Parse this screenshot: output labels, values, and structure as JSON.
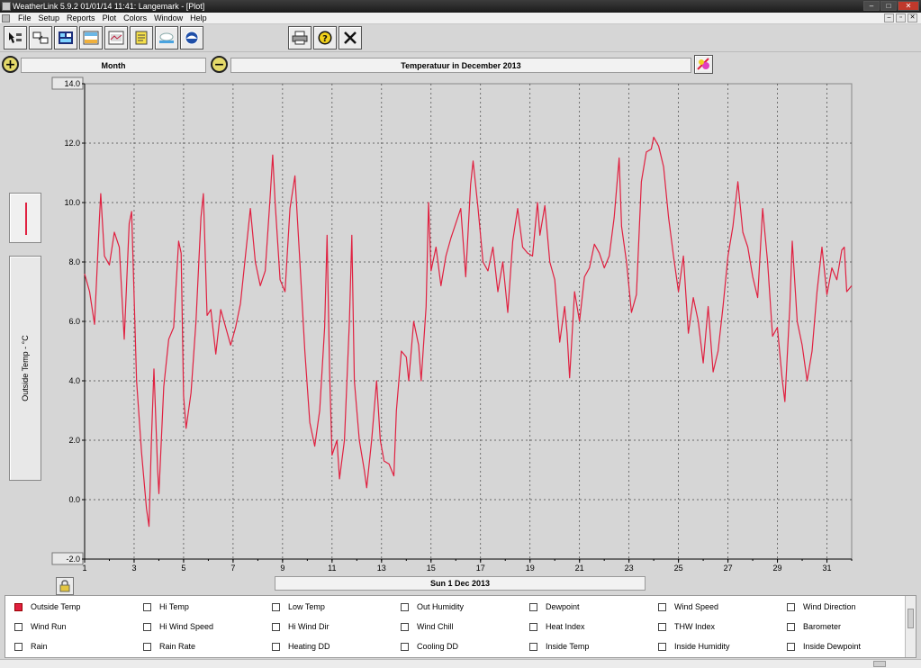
{
  "window": {
    "title": "WeatherLink 5.9.2  01/01/14  11:41: Langemark - [Plot]",
    "controls": [
      "–",
      "□",
      "✕"
    ],
    "mdi_controls": [
      "–",
      "▫",
      "✕"
    ]
  },
  "menu": {
    "items": [
      "File",
      "Setup",
      "Reports",
      "Plot",
      "Colors",
      "Window",
      "Help"
    ]
  },
  "toolbar": {
    "buttons": [
      {
        "name": "select-station-icon"
      },
      {
        "name": "download-icon"
      },
      {
        "name": "bulletin-icon"
      },
      {
        "name": "summary-icon"
      },
      {
        "name": "plot-icon"
      },
      {
        "name": "browse-notes-icon"
      },
      {
        "name": "weather-image-icon"
      },
      {
        "name": "noaa-icon"
      },
      {
        "name": "print-icon"
      },
      {
        "name": "help-icon"
      },
      {
        "name": "close-plot-icon"
      }
    ]
  },
  "header": {
    "period": "Month",
    "plot_title": "Temperatuur in December 2013"
  },
  "y_axis": {
    "title": "Outside Temp - °C"
  },
  "date_label": "Sun 1 Dec 2013",
  "variables": [
    {
      "label": "Outside Temp",
      "checked": true
    },
    {
      "label": "Hi Temp",
      "checked": false
    },
    {
      "label": "Low Temp",
      "checked": false
    },
    {
      "label": "Out Humidity",
      "checked": false
    },
    {
      "label": "Dewpoint",
      "checked": false
    },
    {
      "label": "Wind Speed",
      "checked": false
    },
    {
      "label": "Wind Direction",
      "checked": false
    },
    {
      "label": "Wind Run",
      "checked": false
    },
    {
      "label": "Hi Wind Speed",
      "checked": false
    },
    {
      "label": "Hi Wind Dir",
      "checked": false
    },
    {
      "label": "Wind Chill",
      "checked": false
    },
    {
      "label": "Heat Index",
      "checked": false
    },
    {
      "label": "THW Index",
      "checked": false
    },
    {
      "label": "Barometer",
      "checked": false
    },
    {
      "label": "Rain",
      "checked": false
    },
    {
      "label": "Rain Rate",
      "checked": false
    },
    {
      "label": "Heating DD",
      "checked": false
    },
    {
      "label": "Cooling DD",
      "checked": false
    },
    {
      "label": "Inside Temp",
      "checked": false
    },
    {
      "label": "Inside Humidity",
      "checked": false
    },
    {
      "label": "Inside Dewpoint",
      "checked": false
    }
  ],
  "colors": {
    "series": "#e02040"
  },
  "chart_data": {
    "type": "line",
    "ylim": [
      -2,
      14
    ],
    "xlim": [
      1,
      32
    ],
    "y_ticks": [
      "14.0",
      "12.0",
      "10.0",
      "8.0",
      "6.0",
      "4.0",
      "2.0",
      "0.0",
      "-2.0"
    ],
    "x_ticks": [
      "1",
      "3",
      "5",
      "7",
      "9",
      "11",
      "13",
      "15",
      "17",
      "19",
      "21",
      "23",
      "25",
      "27",
      "29",
      "31"
    ],
    "grid": true,
    "series": [
      {
        "values": [
          [
            1.0,
            7.6
          ],
          [
            1.2,
            7.0
          ],
          [
            1.4,
            5.9
          ],
          [
            1.6,
            9.5
          ],
          [
            1.65,
            10.3
          ],
          [
            1.8,
            8.2
          ],
          [
            2.0,
            7.9
          ],
          [
            2.2,
            9.0
          ],
          [
            2.4,
            8.5
          ],
          [
            2.6,
            5.4
          ],
          [
            2.8,
            9.3
          ],
          [
            2.9,
            9.7
          ],
          [
            3.1,
            4.0
          ],
          [
            3.3,
            1.6
          ],
          [
            3.5,
            -0.3
          ],
          [
            3.6,
            -0.9
          ],
          [
            3.7,
            2.0
          ],
          [
            3.8,
            4.4
          ],
          [
            3.95,
            1.0
          ],
          [
            4.0,
            0.2
          ],
          [
            4.2,
            3.8
          ],
          [
            4.4,
            5.4
          ],
          [
            4.6,
            5.8
          ],
          [
            4.8,
            8.7
          ],
          [
            4.9,
            8.3
          ],
          [
            5.0,
            3.5
          ],
          [
            5.1,
            2.4
          ],
          [
            5.3,
            3.6
          ],
          [
            5.5,
            6.0
          ],
          [
            5.7,
            9.5
          ],
          [
            5.8,
            10.3
          ],
          [
            5.95,
            6.2
          ],
          [
            6.1,
            6.4
          ],
          [
            6.3,
            4.9
          ],
          [
            6.5,
            6.4
          ],
          [
            6.7,
            5.8
          ],
          [
            6.9,
            5.2
          ],
          [
            7.1,
            5.8
          ],
          [
            7.3,
            6.6
          ],
          [
            7.5,
            8.2
          ],
          [
            7.7,
            9.8
          ],
          [
            7.9,
            8.0
          ],
          [
            8.1,
            7.2
          ],
          [
            8.3,
            7.7
          ],
          [
            8.5,
            10.2
          ],
          [
            8.6,
            11.6
          ],
          [
            8.7,
            10.0
          ],
          [
            8.9,
            7.4
          ],
          [
            9.1,
            7.0
          ],
          [
            9.3,
            9.8
          ],
          [
            9.5,
            10.9
          ],
          [
            9.7,
            8.0
          ],
          [
            9.9,
            5.0
          ],
          [
            10.1,
            2.6
          ],
          [
            10.3,
            1.8
          ],
          [
            10.5,
            3.0
          ],
          [
            10.7,
            5.8
          ],
          [
            10.8,
            8.9
          ],
          [
            10.9,
            4.3
          ],
          [
            11.0,
            1.5
          ],
          [
            11.2,
            2.0
          ],
          [
            11.3,
            0.7
          ],
          [
            11.5,
            2.0
          ],
          [
            11.7,
            6.0
          ],
          [
            11.8,
            8.9
          ],
          [
            11.9,
            4.0
          ],
          [
            12.1,
            2.0
          ],
          [
            12.3,
            1.0
          ],
          [
            12.4,
            0.4
          ],
          [
            12.6,
            2.0
          ],
          [
            12.8,
            4.0
          ],
          [
            12.95,
            2.0
          ],
          [
            13.1,
            1.3
          ],
          [
            13.3,
            1.2
          ],
          [
            13.5,
            0.8
          ],
          [
            13.6,
            3.0
          ],
          [
            13.8,
            5.0
          ],
          [
            14.0,
            4.8
          ],
          [
            14.1,
            4.0
          ],
          [
            14.3,
            6.0
          ],
          [
            14.5,
            5.2
          ],
          [
            14.6,
            4.0
          ],
          [
            14.8,
            6.5
          ],
          [
            14.9,
            10.0
          ],
          [
            15.0,
            7.7
          ],
          [
            15.2,
            8.5
          ],
          [
            15.4,
            7.2
          ],
          [
            15.6,
            8.2
          ],
          [
            15.8,
            8.8
          ],
          [
            16.0,
            9.3
          ],
          [
            16.2,
            9.8
          ],
          [
            16.4,
            7.5
          ],
          [
            16.6,
            10.6
          ],
          [
            16.7,
            11.4
          ],
          [
            16.9,
            9.8
          ],
          [
            17.1,
            8.0
          ],
          [
            17.3,
            7.7
          ],
          [
            17.5,
            8.5
          ],
          [
            17.7,
            7.0
          ],
          [
            17.9,
            8.0
          ],
          [
            18.1,
            6.3
          ],
          [
            18.3,
            8.7
          ],
          [
            18.5,
            9.8
          ],
          [
            18.7,
            8.5
          ],
          [
            18.9,
            8.3
          ],
          [
            19.1,
            8.2
          ],
          [
            19.3,
            10.0
          ],
          [
            19.4,
            8.9
          ],
          [
            19.6,
            9.9
          ],
          [
            19.8,
            8.0
          ],
          [
            20.0,
            7.4
          ],
          [
            20.2,
            5.3
          ],
          [
            20.4,
            6.5
          ],
          [
            20.5,
            5.6
          ],
          [
            20.6,
            4.1
          ],
          [
            20.8,
            7.0
          ],
          [
            21.0,
            6.0
          ],
          [
            21.2,
            7.5
          ],
          [
            21.4,
            7.8
          ],
          [
            21.6,
            8.6
          ],
          [
            21.8,
            8.3
          ],
          [
            22.0,
            7.8
          ],
          [
            22.2,
            8.2
          ],
          [
            22.4,
            9.5
          ],
          [
            22.6,
            11.5
          ],
          [
            22.7,
            9.2
          ],
          [
            22.9,
            8.0
          ],
          [
            23.1,
            6.3
          ],
          [
            23.3,
            6.9
          ],
          [
            23.5,
            10.7
          ],
          [
            23.7,
            11.7
          ],
          [
            23.9,
            11.8
          ],
          [
            24.0,
            12.2
          ],
          [
            24.2,
            11.9
          ],
          [
            24.4,
            11.2
          ],
          [
            24.6,
            9.5
          ],
          [
            24.8,
            8.2
          ],
          [
            25.0,
            7.0
          ],
          [
            25.2,
            8.2
          ],
          [
            25.4,
            5.6
          ],
          [
            25.6,
            6.8
          ],
          [
            25.8,
            6.0
          ],
          [
            26.0,
            4.6
          ],
          [
            26.2,
            6.5
          ],
          [
            26.4,
            4.3
          ],
          [
            26.6,
            5.0
          ],
          [
            26.8,
            6.5
          ],
          [
            27.0,
            8.2
          ],
          [
            27.2,
            9.2
          ],
          [
            27.4,
            10.7
          ],
          [
            27.6,
            9.0
          ],
          [
            27.8,
            8.5
          ],
          [
            28.0,
            7.5
          ],
          [
            28.2,
            6.8
          ],
          [
            28.4,
            9.8
          ],
          [
            28.6,
            8.0
          ],
          [
            28.8,
            5.5
          ],
          [
            29.0,
            5.8
          ],
          [
            29.2,
            4.0
          ],
          [
            29.3,
            3.3
          ],
          [
            29.5,
            6.5
          ],
          [
            29.6,
            8.7
          ],
          [
            29.8,
            6.0
          ],
          [
            30.0,
            5.2
          ],
          [
            30.2,
            4.0
          ],
          [
            30.4,
            5.0
          ],
          [
            30.6,
            7.0
          ],
          [
            30.8,
            8.5
          ],
          [
            31.0,
            6.9
          ],
          [
            31.2,
            7.8
          ],
          [
            31.4,
            7.4
          ],
          [
            31.6,
            8.4
          ],
          [
            31.7,
            8.5
          ],
          [
            31.8,
            7.0
          ],
          [
            32.0,
            7.2
          ]
        ]
      }
    ]
  }
}
